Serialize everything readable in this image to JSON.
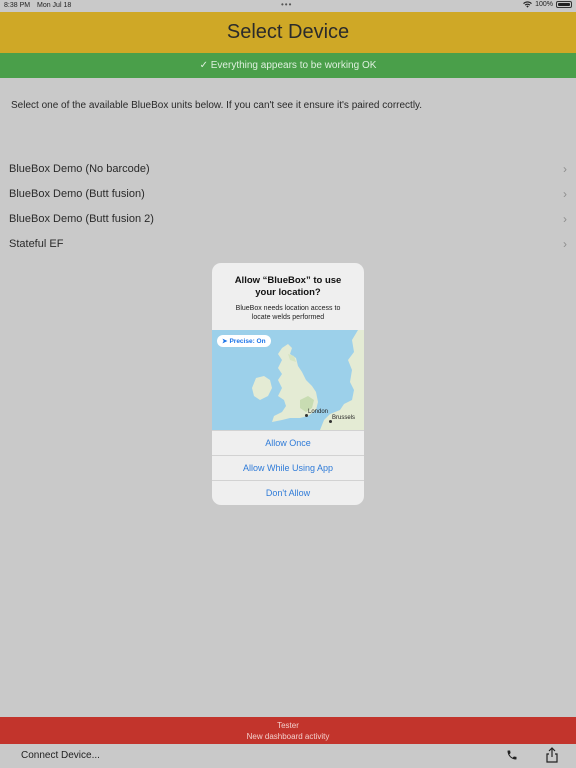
{
  "status_bar": {
    "time": "8:38 PM",
    "date": "Mon Jul 18",
    "battery": "100%"
  },
  "header": {
    "title": "Select Device"
  },
  "banner": {
    "text": "✓ Everything appears to be working OK"
  },
  "instructions": "Select one of the available BlueBox units below. If you can't see it ensure it's paired correctly.",
  "devices": [
    {
      "label": "BlueBox Demo (No barcode)"
    },
    {
      "label": "BlueBox Demo (Butt fusion)"
    },
    {
      "label": "BlueBox Demo (Butt fusion 2)"
    },
    {
      "label": "Stateful EF"
    }
  ],
  "dialog": {
    "title": "Allow “BlueBox” to use your location?",
    "message": "BlueBox needs location access to locate welds performed",
    "precise_label": "Precise: On",
    "map_labels": {
      "london": "London",
      "brussels": "Brussels"
    },
    "buttons": {
      "allow_once": "Allow Once",
      "allow_while_using": "Allow While Using App",
      "dont_allow": "Don't Allow"
    }
  },
  "bottom_alert": {
    "line1": "Tester",
    "line2": "New dashboard activity"
  },
  "toolbar": {
    "connect_label": "Connect Device..."
  },
  "colors": {
    "header": "#cfa826",
    "banner": "#4a9f4a",
    "alert": "#c2342c",
    "link": "#2f7bd8"
  }
}
